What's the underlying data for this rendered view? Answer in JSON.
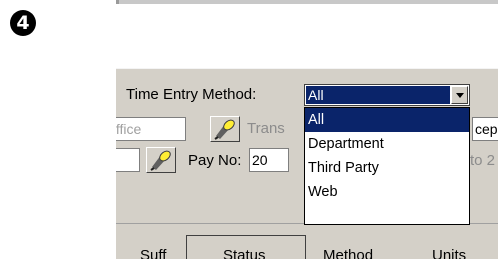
{
  "step_number": "4",
  "form": {
    "time_entry_label": "Time Entry Method:",
    "time_entry_selected": "All",
    "office_value": "Office",
    "trans_label": "Trans",
    "trans_right": "cep",
    "pay_no_label": "Pay No:",
    "pay_no_value": "20",
    "pay_right": "to 2"
  },
  "dropdown": {
    "options": [
      "All",
      "Department",
      "Third Party",
      "Web"
    ]
  },
  "columns": [
    "Suff",
    "Status",
    "Method",
    "Units"
  ],
  "colors": {
    "selection": "#0a246a",
    "panel": "#d4d0c8"
  }
}
